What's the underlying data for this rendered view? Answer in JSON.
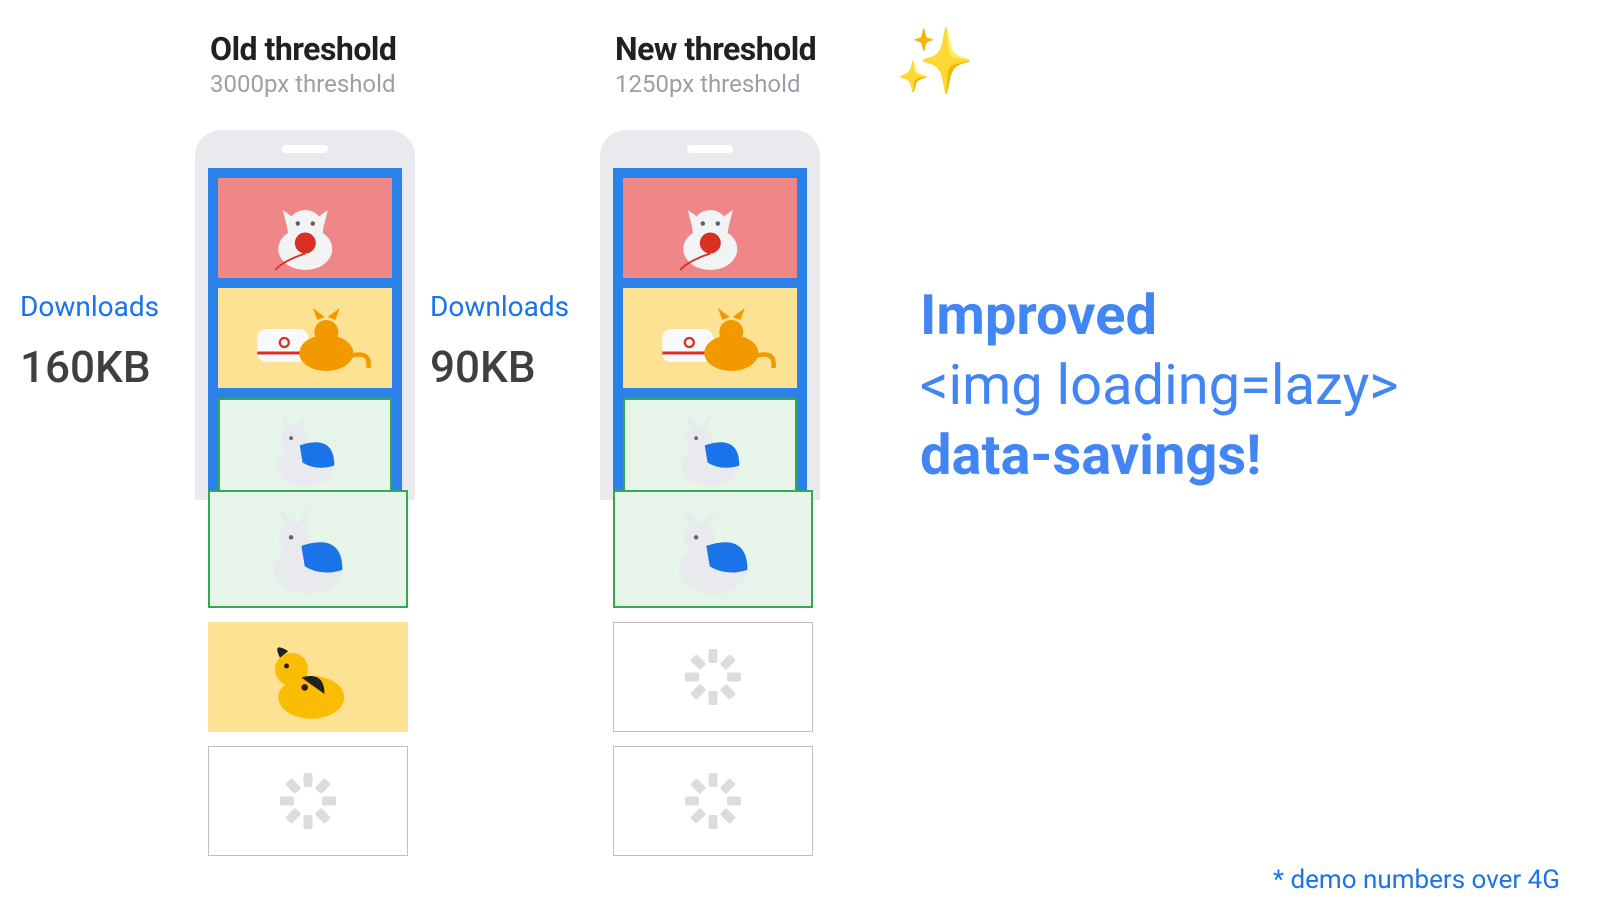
{
  "old": {
    "title": "Old threshold",
    "subtitle": "3000px threshold",
    "downloads_label": "Downloads",
    "downloads_value": "160KB"
  },
  "new": {
    "title": "New threshold",
    "subtitle": "1250px threshold",
    "downloads_label": "Downloads",
    "downloads_value": "90KB"
  },
  "headline": {
    "line1": "Improved",
    "line2": "<img loading=lazy>",
    "line3": "data-savings!"
  },
  "footnote": "* demo numbers over 4G",
  "sparkle": "✨"
}
